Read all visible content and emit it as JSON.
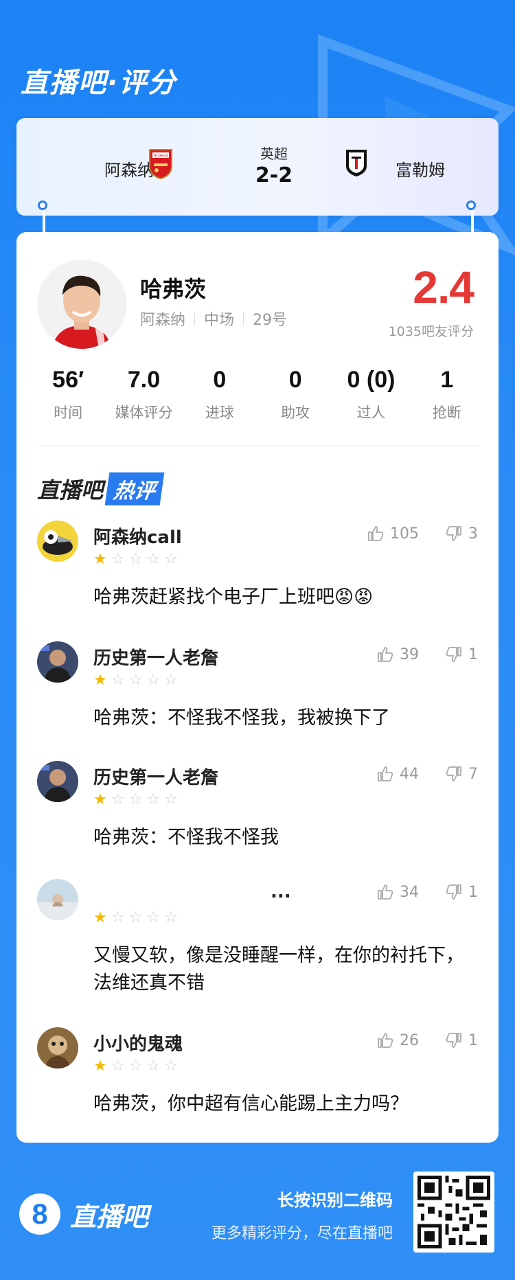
{
  "header": {
    "title": "直播吧·评分"
  },
  "match": {
    "home_team": "阿森纳",
    "away_team": "富勒姆",
    "league": "英超",
    "score": "2-2",
    "home_logo_text": "Arsenal"
  },
  "player": {
    "name": "哈弗茨",
    "team": "阿森纳",
    "position": "中场",
    "number": "29号",
    "rating": "2.4",
    "rating_count": "1035吧友评分"
  },
  "stats": [
    {
      "value": "56′",
      "label": "时间"
    },
    {
      "value": "7.0",
      "label": "媒体评分"
    },
    {
      "value": "0",
      "label": "进球"
    },
    {
      "value": "0",
      "label": "助攻"
    },
    {
      "value": "0 (0)",
      "label": "过人"
    },
    {
      "value": "1",
      "label": "抢断"
    }
  ],
  "hot_comments": {
    "title_part1": "直播吧",
    "title_part2": "热评",
    "items": [
      {
        "user": "阿森纳call",
        "stars": 1,
        "likes": "105",
        "dislikes": "3",
        "text": "哈弗茨赶紧找个电子厂上班吧😡😡"
      },
      {
        "user": "历史第一人老詹",
        "stars": 1,
        "likes": "39",
        "dislikes": "1",
        "text": "哈弗茨：不怪我不怪我，我被换下了"
      },
      {
        "user": "历史第一人老詹",
        "stars": 1,
        "likes": "44",
        "dislikes": "7",
        "text": "哈弗茨：不怪我不怪我"
      },
      {
        "user": "...",
        "stars": 1,
        "likes": "34",
        "dislikes": "1",
        "text": "又慢又软，像是没睡醒一样，在你的衬托下，法维还真不错"
      },
      {
        "user": "小小的鬼魂",
        "stars": 1,
        "likes": "26",
        "dislikes": "1",
        "text": "哈弗茨，你中超有信心能踢上主力吗？"
      }
    ]
  },
  "footer": {
    "brand_number": "8",
    "brand_name": "直播吧",
    "qr_title": "长按识别二维码",
    "qr_sub": "更多精彩评分，尽在直播吧"
  },
  "colors": {
    "accent": "#2b7bf0",
    "rating": "#e53935",
    "star_on": "#f5b800",
    "star_off": "#cfcfcf"
  },
  "icons": {
    "like": "thumbs-up-icon",
    "dislike": "thumbs-down-icon"
  }
}
